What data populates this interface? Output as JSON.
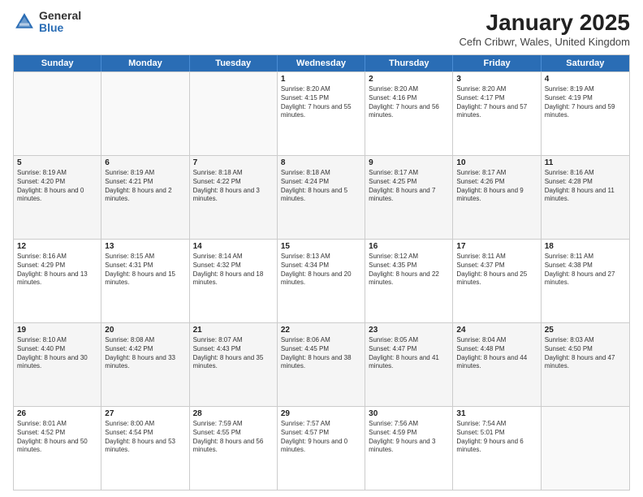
{
  "logo": {
    "general": "General",
    "blue": "Blue"
  },
  "title": "January 2025",
  "location": "Cefn Cribwr, Wales, United Kingdom",
  "days": [
    "Sunday",
    "Monday",
    "Tuesday",
    "Wednesday",
    "Thursday",
    "Friday",
    "Saturday"
  ],
  "weeks": [
    [
      {
        "day": "",
        "sunrise": "",
        "sunset": "",
        "daylight": ""
      },
      {
        "day": "",
        "sunrise": "",
        "sunset": "",
        "daylight": ""
      },
      {
        "day": "",
        "sunrise": "",
        "sunset": "",
        "daylight": ""
      },
      {
        "day": "1",
        "sunrise": "Sunrise: 8:20 AM",
        "sunset": "Sunset: 4:15 PM",
        "daylight": "Daylight: 7 hours and 55 minutes."
      },
      {
        "day": "2",
        "sunrise": "Sunrise: 8:20 AM",
        "sunset": "Sunset: 4:16 PM",
        "daylight": "Daylight: 7 hours and 56 minutes."
      },
      {
        "day": "3",
        "sunrise": "Sunrise: 8:20 AM",
        "sunset": "Sunset: 4:17 PM",
        "daylight": "Daylight: 7 hours and 57 minutes."
      },
      {
        "day": "4",
        "sunrise": "Sunrise: 8:19 AM",
        "sunset": "Sunset: 4:19 PM",
        "daylight": "Daylight: 7 hours and 59 minutes."
      }
    ],
    [
      {
        "day": "5",
        "sunrise": "Sunrise: 8:19 AM",
        "sunset": "Sunset: 4:20 PM",
        "daylight": "Daylight: 8 hours and 0 minutes."
      },
      {
        "day": "6",
        "sunrise": "Sunrise: 8:19 AM",
        "sunset": "Sunset: 4:21 PM",
        "daylight": "Daylight: 8 hours and 2 minutes."
      },
      {
        "day": "7",
        "sunrise": "Sunrise: 8:18 AM",
        "sunset": "Sunset: 4:22 PM",
        "daylight": "Daylight: 8 hours and 3 minutes."
      },
      {
        "day": "8",
        "sunrise": "Sunrise: 8:18 AM",
        "sunset": "Sunset: 4:24 PM",
        "daylight": "Daylight: 8 hours and 5 minutes."
      },
      {
        "day": "9",
        "sunrise": "Sunrise: 8:17 AM",
        "sunset": "Sunset: 4:25 PM",
        "daylight": "Daylight: 8 hours and 7 minutes."
      },
      {
        "day": "10",
        "sunrise": "Sunrise: 8:17 AM",
        "sunset": "Sunset: 4:26 PM",
        "daylight": "Daylight: 8 hours and 9 minutes."
      },
      {
        "day": "11",
        "sunrise": "Sunrise: 8:16 AM",
        "sunset": "Sunset: 4:28 PM",
        "daylight": "Daylight: 8 hours and 11 minutes."
      }
    ],
    [
      {
        "day": "12",
        "sunrise": "Sunrise: 8:16 AM",
        "sunset": "Sunset: 4:29 PM",
        "daylight": "Daylight: 8 hours and 13 minutes."
      },
      {
        "day": "13",
        "sunrise": "Sunrise: 8:15 AM",
        "sunset": "Sunset: 4:31 PM",
        "daylight": "Daylight: 8 hours and 15 minutes."
      },
      {
        "day": "14",
        "sunrise": "Sunrise: 8:14 AM",
        "sunset": "Sunset: 4:32 PM",
        "daylight": "Daylight: 8 hours and 18 minutes."
      },
      {
        "day": "15",
        "sunrise": "Sunrise: 8:13 AM",
        "sunset": "Sunset: 4:34 PM",
        "daylight": "Daylight: 8 hours and 20 minutes."
      },
      {
        "day": "16",
        "sunrise": "Sunrise: 8:12 AM",
        "sunset": "Sunset: 4:35 PM",
        "daylight": "Daylight: 8 hours and 22 minutes."
      },
      {
        "day": "17",
        "sunrise": "Sunrise: 8:11 AM",
        "sunset": "Sunset: 4:37 PM",
        "daylight": "Daylight: 8 hours and 25 minutes."
      },
      {
        "day": "18",
        "sunrise": "Sunrise: 8:11 AM",
        "sunset": "Sunset: 4:38 PM",
        "daylight": "Daylight: 8 hours and 27 minutes."
      }
    ],
    [
      {
        "day": "19",
        "sunrise": "Sunrise: 8:10 AM",
        "sunset": "Sunset: 4:40 PM",
        "daylight": "Daylight: 8 hours and 30 minutes."
      },
      {
        "day": "20",
        "sunrise": "Sunrise: 8:08 AM",
        "sunset": "Sunset: 4:42 PM",
        "daylight": "Daylight: 8 hours and 33 minutes."
      },
      {
        "day": "21",
        "sunrise": "Sunrise: 8:07 AM",
        "sunset": "Sunset: 4:43 PM",
        "daylight": "Daylight: 8 hours and 35 minutes."
      },
      {
        "day": "22",
        "sunrise": "Sunrise: 8:06 AM",
        "sunset": "Sunset: 4:45 PM",
        "daylight": "Daylight: 8 hours and 38 minutes."
      },
      {
        "day": "23",
        "sunrise": "Sunrise: 8:05 AM",
        "sunset": "Sunset: 4:47 PM",
        "daylight": "Daylight: 8 hours and 41 minutes."
      },
      {
        "day": "24",
        "sunrise": "Sunrise: 8:04 AM",
        "sunset": "Sunset: 4:48 PM",
        "daylight": "Daylight: 8 hours and 44 minutes."
      },
      {
        "day": "25",
        "sunrise": "Sunrise: 8:03 AM",
        "sunset": "Sunset: 4:50 PM",
        "daylight": "Daylight: 8 hours and 47 minutes."
      }
    ],
    [
      {
        "day": "26",
        "sunrise": "Sunrise: 8:01 AM",
        "sunset": "Sunset: 4:52 PM",
        "daylight": "Daylight: 8 hours and 50 minutes."
      },
      {
        "day": "27",
        "sunrise": "Sunrise: 8:00 AM",
        "sunset": "Sunset: 4:54 PM",
        "daylight": "Daylight: 8 hours and 53 minutes."
      },
      {
        "day": "28",
        "sunrise": "Sunrise: 7:59 AM",
        "sunset": "Sunset: 4:55 PM",
        "daylight": "Daylight: 8 hours and 56 minutes."
      },
      {
        "day": "29",
        "sunrise": "Sunrise: 7:57 AM",
        "sunset": "Sunset: 4:57 PM",
        "daylight": "Daylight: 9 hours and 0 minutes."
      },
      {
        "day": "30",
        "sunrise": "Sunrise: 7:56 AM",
        "sunset": "Sunset: 4:59 PM",
        "daylight": "Daylight: 9 hours and 3 minutes."
      },
      {
        "day": "31",
        "sunrise": "Sunrise: 7:54 AM",
        "sunset": "Sunset: 5:01 PM",
        "daylight": "Daylight: 9 hours and 6 minutes."
      },
      {
        "day": "",
        "sunrise": "",
        "sunset": "",
        "daylight": ""
      }
    ]
  ]
}
